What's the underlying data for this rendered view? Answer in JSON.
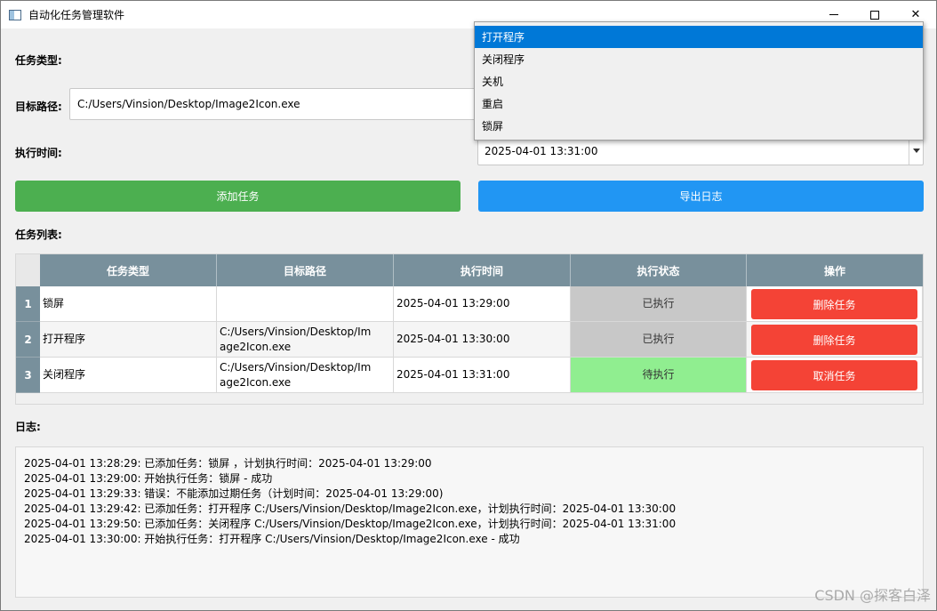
{
  "window": {
    "title": "自动化任务管理软件",
    "min_label": "—",
    "close_label": "✕"
  },
  "form": {
    "task_type_label": "任务类型:",
    "target_path_label": "目标路径:",
    "target_path_value": "C:/Users/Vinsion/Desktop/Image2Icon.exe",
    "exec_time_label": "执行时间:",
    "exec_time_value": "2025-04-01 13:31:00",
    "add_button": "添加任务",
    "export_button": "导出日志"
  },
  "task_type_dropdown": {
    "options": [
      "打开程序",
      "关闭程序",
      "关机",
      "重启",
      "锁屏"
    ],
    "selected_index": 0
  },
  "table": {
    "title": "任务列表:",
    "headers": [
      "任务类型",
      "目标路径",
      "执行时间",
      "执行状态",
      "操作"
    ],
    "rows": [
      {
        "index": "1",
        "type": "锁屏",
        "path": "",
        "time": "2025-04-01 13:29:00",
        "status": "已执行",
        "action": "删除任务"
      },
      {
        "index": "2",
        "type": "打开程序",
        "path": "C:/Users/Vinsion/Desktop/Image2Icon.exe",
        "time": "2025-04-01 13:30:00",
        "status": "已执行",
        "action": "删除任务"
      },
      {
        "index": "3",
        "type": "关闭程序",
        "path": "C:/Users/Vinsion/Desktop/Image2Icon.exe",
        "time": "2025-04-01 13:31:00",
        "status": "待执行",
        "action": "取消任务"
      }
    ]
  },
  "log": {
    "title": "日志:",
    "lines": [
      "2025-04-01 13:28:29: 已添加任务：锁屏 ，计划执行时间：2025-04-01 13:29:00",
      "2025-04-01 13:29:00: 开始执行任务：锁屏  - 成功",
      "2025-04-01 13:29:33: 错误：不能添加过期任务（计划时间：2025-04-01 13:29:00)",
      "2025-04-01 13:29:42: 已添加任务：打开程序 C:/Users/Vinsion/Desktop/Image2Icon.exe，计划执行时间：2025-04-01 13:30:00",
      "2025-04-01 13:29:50: 已添加任务：关闭程序 C:/Users/Vinsion/Desktop/Image2Icon.exe，计划执行时间：2025-04-01 13:31:00",
      "2025-04-01 13:30:00: 开始执行任务：打开程序 C:/Users/Vinsion/Desktop/Image2Icon.exe - 成功"
    ]
  },
  "colors": {
    "add_button": "#4caf50",
    "export_button": "#2196f3",
    "header": "#78909c",
    "status_done": "#c8c8c8",
    "status_wait": "#90ee90",
    "action_button": "#f44336",
    "dropdown_selected": "#0078d7"
  },
  "watermark": "CSDN @探客白泽"
}
